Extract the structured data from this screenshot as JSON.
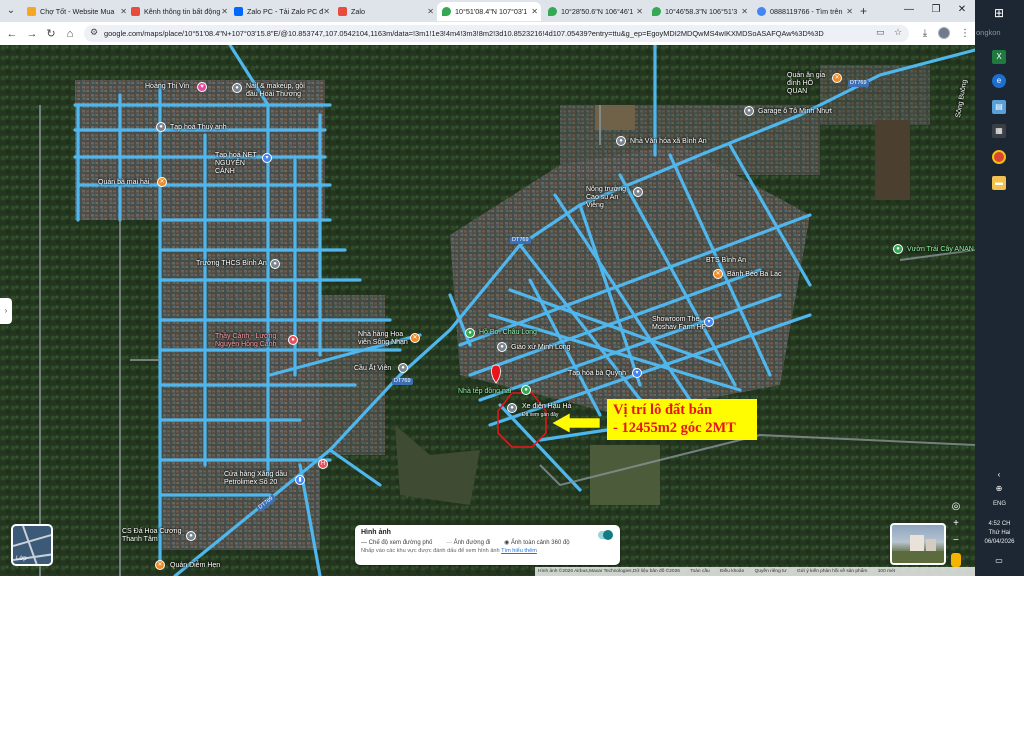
{
  "tabs": [
    {
      "label": "Chợ Tốt - Website Mua",
      "favicon_color": "#f5a623",
      "active": false
    },
    {
      "label": "Kênh thông tin bất động",
      "favicon_color": "#e74c3c",
      "active": false
    },
    {
      "label": "Zalo PC - Tải Zalo PC đ",
      "favicon_color": "#0068ff",
      "active": false
    },
    {
      "label": "Zalo",
      "favicon_color": "#e74c3c",
      "active": false
    },
    {
      "label": "10°51'08.4\"N 107°03'1",
      "favicon_color": "#34a853",
      "active": true
    },
    {
      "label": "10°28'50.6\"N 106°46'1",
      "favicon_color": "#34a853",
      "active": false
    },
    {
      "label": "10°46'58.3\"N 106°51'3",
      "favicon_color": "#34a853",
      "active": false
    },
    {
      "label": "0888119766 - Tìm trên",
      "favicon_color": "#4285f4",
      "active": false
    }
  ],
  "new_tab_label": "+",
  "window_controls": {
    "minimize": "—",
    "restore": "❐",
    "close": "✕"
  },
  "omnibox": {
    "url": "google.com/maps/place/10°51'08.4\"N+107°03'15.8\"E/@10.853747,107.0542104,1163m/data=!3m1!1e3!4m4!3m3!8m2!3d10.8523216!4d107.05439?entry=ttu&g_ep=EgoyMDI2MDQwMS4wIKXMDSoASAFQAw%3D%3D"
  },
  "map": {
    "pois": [
      {
        "label": "Hoàng Thị Vin",
        "color": "white"
      },
      {
        "label": "Nail & makeup, gội đầu Hoài Thương",
        "color": "white"
      },
      {
        "label": "Tạp hoá Thuỳ anh",
        "color": "white"
      },
      {
        "label": "Tạp hoá NET NGUYỄN CẢNH",
        "color": "white"
      },
      {
        "label": "Quán bà mai hải",
        "color": "white"
      },
      {
        "label": "Trường THCS Bình An",
        "color": "white"
      },
      {
        "label": "Thầy Cảnh - Lương Nguyễn Hồng Cảnh",
        "color": "pink"
      },
      {
        "label": "Nhà hàng Hoa viên Sông Nhạn",
        "color": "white"
      },
      {
        "label": "Cầu Ất Viên",
        "color": "white"
      },
      {
        "label": "Cửa hàng Xăng dầu Petrolimex Số 20",
        "color": "white"
      },
      {
        "label": "CS Đá Hoa Cương Thanh Tâm",
        "color": "white"
      },
      {
        "label": "Quán Diễm Hẹn",
        "color": "white"
      },
      {
        "label": "Nhà Văn hóa xã Bình An",
        "color": "white"
      },
      {
        "label": "Nông trường Cao su An Viễng",
        "color": "white"
      },
      {
        "label": "Quán ăn gia đình HỒ QUAN",
        "color": "white"
      },
      {
        "label": "Garage ô Tô Minh Nhựt",
        "color": "white"
      },
      {
        "label": "BTS Bình An",
        "color": "white"
      },
      {
        "label": "Bánh Bèo Ba Lạc",
        "color": "white"
      },
      {
        "label": "Showroom The Moshav Farm HF",
        "color": "white"
      },
      {
        "label": "Hồ Bơi Châu Long",
        "color": "green"
      },
      {
        "label": "Giáo xứ Minh Long",
        "color": "white"
      },
      {
        "label": "Tạp hóa bà Quỳnh",
        "color": "white"
      },
      {
        "label": "Nhà tếp đồng nai",
        "color": "green"
      },
      {
        "label": "Xe điện Hậu Hà",
        "color": "white"
      },
      {
        "label": "Đã xem gần đây",
        "color": "white"
      },
      {
        "label": "Vườn Trái Cây ANAN",
        "color": "green"
      },
      {
        "label": "Sông Buông",
        "color": "white"
      }
    ],
    "road_labels": [
      "DT769",
      "DT769",
      "DT769",
      "DT769"
    ],
    "sale_annotation": {
      "line1": "Vị trí lô đất bán",
      "line2": "- 12455m2 góc 2MT"
    },
    "layer_button_label": "Lớp",
    "legend": {
      "title": "Hình ảnh",
      "items": [
        "Chế độ xem đường phố",
        "Ảnh đường đi",
        "Ảnh toàn cảnh 360 độ"
      ],
      "hint": "Nhấp vào các khu vực được đánh dấu để xem hình ảnh",
      "hint_link": "Tìm hiểu thêm"
    },
    "footer": [
      "Hình ảnh ©2026 Airbus,Maxar Technologies,Dữ liệu bản đồ ©2026",
      "Toàn cầu",
      "Điều khoản",
      "Quyền riêng tư",
      "Gửi ý kiến phản hồi về sản phẩm",
      "100 mét"
    ]
  },
  "taskbar": {
    "lang": "ENG",
    "time": "4:52 CH",
    "weekday": "Thứ Hai",
    "date": "06/04/2026",
    "watermark": "ongkon"
  },
  "colors": {
    "road": "#4fb7ee",
    "marker": "#e8141c",
    "annotation_bg": "#fffb00",
    "annotation_text": "#e8141c"
  }
}
